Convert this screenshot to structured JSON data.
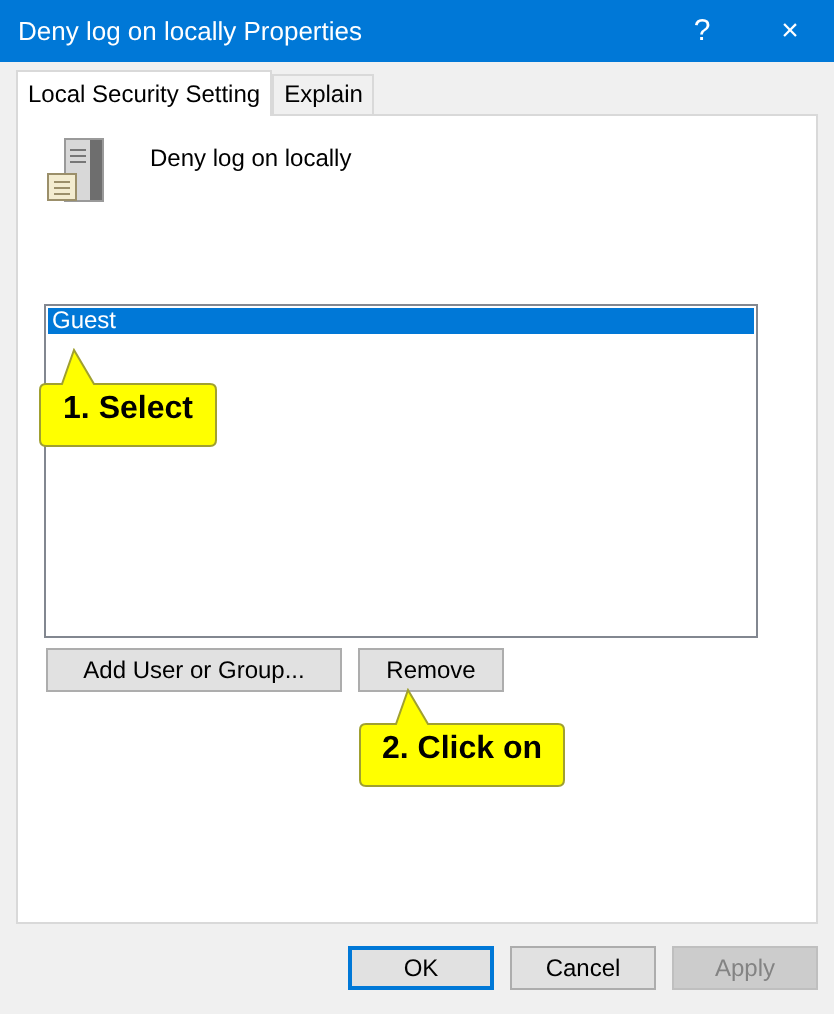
{
  "window": {
    "title": "Deny log on locally Properties",
    "help": "?",
    "close": "×"
  },
  "tabs": [
    {
      "label": "Local Security Setting",
      "selected": true
    },
    {
      "label": "Explain",
      "selected": false
    }
  ],
  "policy": {
    "name": "Deny log on locally"
  },
  "accounts": [
    {
      "name": "Guest",
      "selected": true
    }
  ],
  "actions": [
    {
      "label": "Add User or Group...",
      "disabled": false
    },
    {
      "label": "Remove",
      "disabled": false
    }
  ],
  "callouts": [
    {
      "text": "1. Select"
    },
    {
      "text": "2. Click on"
    }
  ],
  "dialog_buttons": [
    {
      "label": "OK",
      "default": true,
      "disabled": false
    },
    {
      "label": "Cancel",
      "default": false,
      "disabled": false
    },
    {
      "label": "Apply",
      "default": false,
      "disabled": true
    }
  ]
}
